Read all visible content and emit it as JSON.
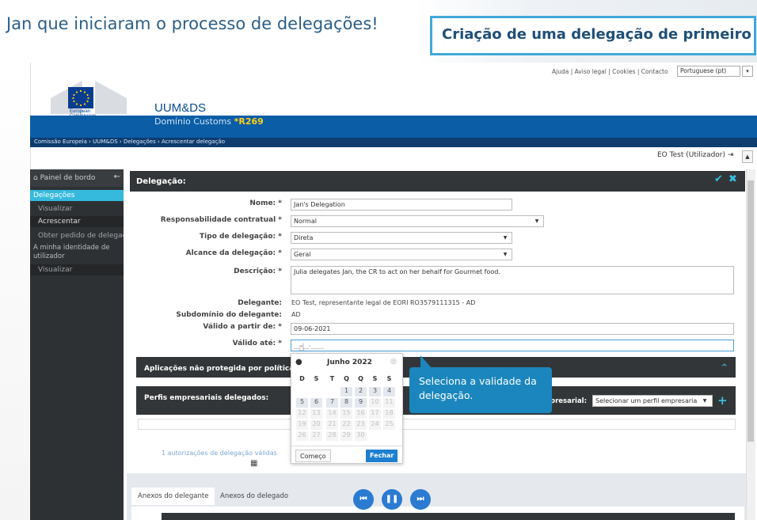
{
  "slide": {
    "title_left": "Jan que iniciaram o processo de delegações!",
    "title_right": "Criação de uma delegação de primeiro nível"
  },
  "topbar": {
    "links": "Ajuda | Aviso legal | Cookies | Contacto",
    "language": "Portuguese (pt)",
    "dropdown_glyph": "▾"
  },
  "logo": {
    "line1": "European",
    "line2": "Commission"
  },
  "app": {
    "name": "UUM&DS",
    "domain_label": "Domínio Customs ",
    "domain_code": "*R269",
    "breadcrumb": "Comissão Europeia › UUM&DS › Delegações › Acrescentar delegação",
    "user": "EO Test (Utilizador)",
    "logout_icon": "⇥",
    "scroll_up": "▲"
  },
  "sidebar": {
    "header": "Painel de bordo",
    "back_icon": "←",
    "home_icon": "⌂",
    "items": [
      {
        "label": "Delegações"
      },
      {
        "label": "Visualizar"
      },
      {
        "label": "Acrescentar"
      },
      {
        "label": "Obter pedido de delegação"
      },
      {
        "label": "A minha identidade de utilizador"
      },
      {
        "label": "Visualizar"
      }
    ]
  },
  "panel": {
    "title": "Delegação:",
    "ok_icon": "✔",
    "close_icon": "✖"
  },
  "form": {
    "nome_label": "Nome: *",
    "nome_value": "Jan's Delegation",
    "resp_label": "Responsabilidade contratual *",
    "resp_value": "Normal",
    "tipo_label": "Tipo de delegação: *",
    "tipo_value": "Direta",
    "alcance_label": "Alcance da delegação: *",
    "alcance_value": "Geral",
    "descricao_label": "Descrição: *",
    "descricao_value": "Julia delegates Jan, the CR to act on her behalf for Gourmet food.",
    "delegante_label": "Delegante:",
    "delegante_value": "EO Test, representante legal de EORI RO3579111315 - AD",
    "subdominio_label": "Subdomínio do delegante:",
    "subdominio_value": "AD",
    "valido_de_label": "Válido a partir de: *",
    "valido_de_value": "09-06-2021",
    "valido_ate_label": "Válido até: *",
    "valido_ate_placeholder": "__-__-____"
  },
  "sections": {
    "aplicacoes": "Aplicações não protegida por políticas",
    "perfis": "Perfis empresariais delegados:",
    "perfil_empresarial_label": "presarial:",
    "perfil_select": "Selecionar um perfil empresaria",
    "add_icon": "+",
    "collapse_icon": "^",
    "autorizacoes": "1 autorizações de delegação válidas"
  },
  "calendar": {
    "month": "Junho 2022",
    "weekdays": [
      "D",
      "S",
      "T",
      "Q",
      "Q",
      "S",
      "S"
    ],
    "rows": [
      [
        "",
        "",
        "",
        "1",
        "2",
        "3",
        "4"
      ],
      [
        "5",
        "6",
        "7",
        "8",
        "9",
        "10",
        "11"
      ],
      [
        "12",
        "13",
        "14",
        "15",
        "16",
        "17",
        "18"
      ],
      [
        "19",
        "20",
        "21",
        "22",
        "23",
        "24",
        "25"
      ],
      [
        "26",
        "27",
        "28",
        "29",
        "30",
        "",
        ""
      ]
    ],
    "start_button": "Começo",
    "close_button": "Fechar"
  },
  "tooltip": {
    "text": "Seleciona a validade da delegação."
  },
  "tabs": [
    "Anexos do delegante",
    "Anexos do delegado"
  ],
  "media": {
    "prev": "⏮",
    "pause": "❚❚",
    "next": "⏭"
  }
}
